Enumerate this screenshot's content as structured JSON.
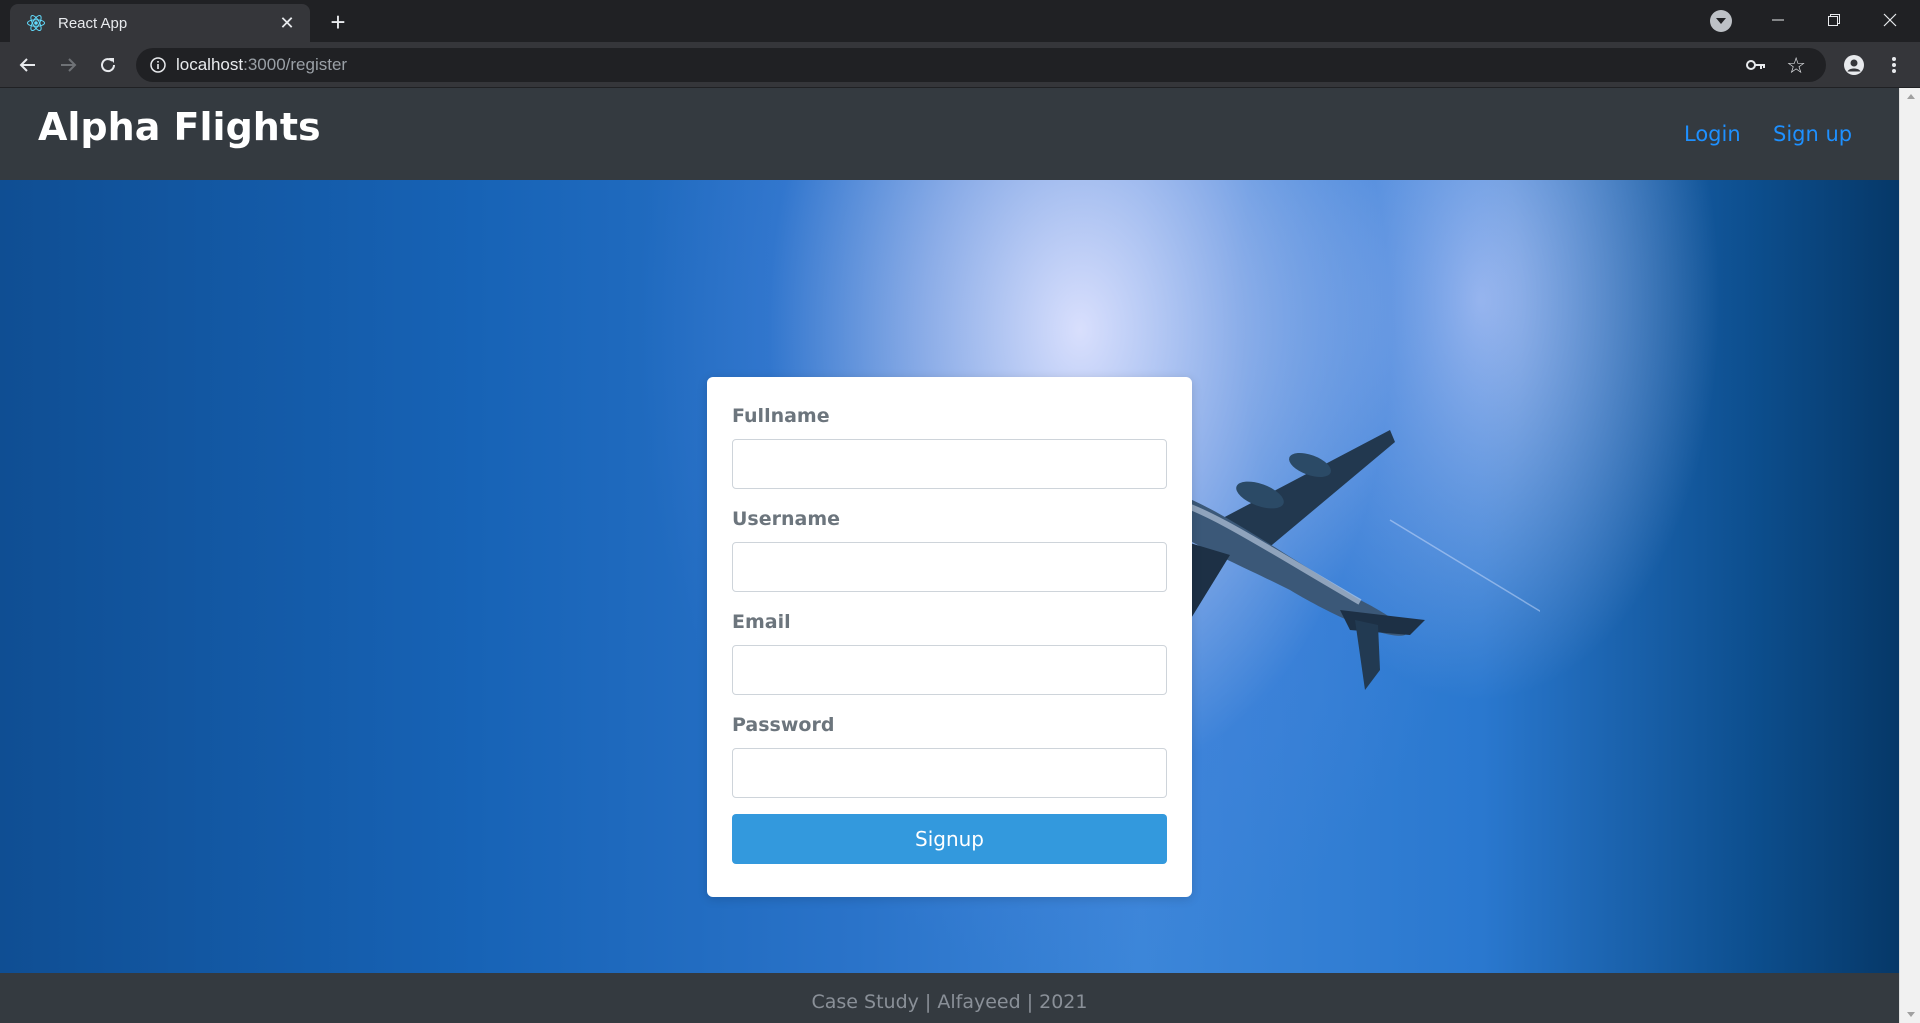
{
  "browser": {
    "tab": {
      "title": "React App",
      "favicon": "react-logo-icon",
      "close_glyph": "✕"
    },
    "new_tab_glyph": "+",
    "url": {
      "host": "localhost",
      "path": ":3000/register"
    },
    "icons": [
      "back-arrow-icon",
      "forward-arrow-icon",
      "reload-icon",
      "site-info-icon",
      "key-icon",
      "star-icon",
      "account-icon",
      "kebab-menu-icon",
      "minimize-icon",
      "restore-icon",
      "close-window-icon"
    ]
  },
  "navbar": {
    "brand": "Alpha Flights",
    "links": [
      "Login",
      "Sign up"
    ],
    "bg_color": "#343a40",
    "link_color": "#1e90ff"
  },
  "form": {
    "fields": [
      {
        "label": "Fullname",
        "value": ""
      },
      {
        "label": "Username",
        "value": ""
      },
      {
        "label": "Email",
        "value": ""
      },
      {
        "label": "Password",
        "value": ""
      }
    ],
    "submit_label": "Signup",
    "button_color": "#3399dd"
  },
  "footer": {
    "text": "Case Study | Alfayeed | 2021"
  }
}
